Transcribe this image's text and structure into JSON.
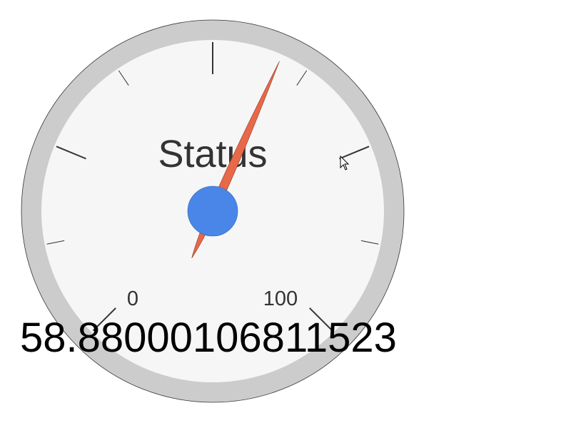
{
  "chart_data": {
    "type": "gauge",
    "title": "Status",
    "min": 0,
    "max": 100,
    "value": 58.88000106811523,
    "value_text": "58.88000106811523",
    "scale_labels": [
      "0",
      "100"
    ],
    "major_tick_count": 5,
    "minor_ticks_between_majors": 1
  },
  "colors": {
    "rim": "#cccccc",
    "face": "#f6f6f6",
    "needle": "#e8684a",
    "hub": "#4a86e8",
    "tick": "#333333",
    "text": "#333333"
  },
  "icons": {
    "cursor": "arrow-cursor-icon"
  }
}
